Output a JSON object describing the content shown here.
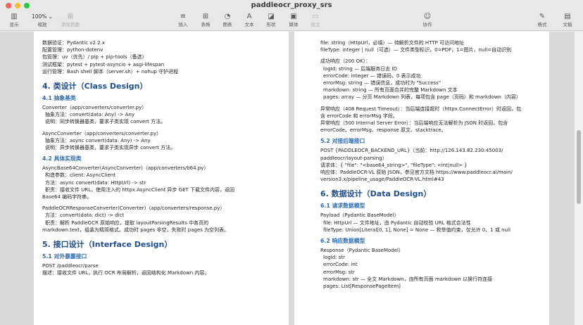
{
  "window": {
    "title": "paddleocr_proxy_srs"
  },
  "toolbar": {
    "view": "显示",
    "zoom_value": "100%",
    "zoom": "缩放",
    "add_page": "添加页面",
    "insert": "插入",
    "table": "表格",
    "chart": "图表",
    "text": "文本",
    "shape": "形状",
    "media": "媒体",
    "comment": "批注",
    "collaborate": "协作",
    "format": "格式",
    "document": "文稿"
  },
  "left_page": {
    "lines_top": [
      "数据验证：Pydantic v2 2.x",
      "配置管理：python-dotenv",
      "包管理：uv（优先）/ pip + pip-tools（备选）",
      "测试框架：pytest + pytest-asyncio + asgi-lifespan",
      "运行管理：Bash shell 脚本（server.sh）+ nohup 守护进程"
    ],
    "h_class": "4. 类设计（Class Design）",
    "h_abstract": "4.1 抽象基类",
    "converter": [
      "Converter（app/converters/converter.py）",
      "抽象方法：convert(data: Any) -> Any",
      "说明：同步转换器基类，要求子类实现 convert 方法。"
    ],
    "async_converter": [
      "AsyncConverter（app/converters/converter.py）",
      "抽象方法：async convert(data: Any) -> Any",
      "说明：异步转换器基类，要求子类实现异步 convert 方法。"
    ],
    "h_impl": "4.2 具体实现类",
    "b64": [
      "AsyncBase64Converter(AsyncConverter)（app/converters/b64.py）",
      "构造参数：client: AsyncClient",
      "方法：async convert(data: HttpUrl) -> str",
      "职责：接收文件 URL，使用注入的 httpx.AsyncClient 异步 GET 下载文件内容，返回",
      "Base64 编码字符串。"
    ],
    "resp_conv": [
      "PaddleOCRResponseConverter(Converter)（app/converters/response.py）",
      "方法：convert(data: dict) -> dict",
      "职责：解析 PaddleOCR 原始响应，提取 layoutParsingResults 中各页的",
      "markdown.text，组装为精简格式。成功时 pages 非空，失败时 pages 为空列表。"
    ],
    "h_interface": "5. 接口设计（Interface Design）",
    "h_exposed": "5.1 对外暴露接口",
    "parse": [
      "POST /paddleocr/parse",
      "描述：接收文件 URL，执行 OCR 布局解析，返回结构化 Markdown 内容。"
    ]
  },
  "right_page": {
    "params": [
      "file: string（HttpUrl，必填）— 待解析文件的 HTTP 可访问地址",
      "fileType: integer | null（可选）— 文件类型标识，0=PDF，1=图片，null=自动识别"
    ],
    "ok": [
      "成功响应（200 OK）：",
      "logId: string — 后端服务日志 ID",
      "errorCode: integer — 错误码，0 表示成功",
      "errorMsg: string — 错误信息，成功时为 \"Success\"",
      "markdown: string — 所有页面合并的完整 Markdown 文本",
      "pages: array — 分页 Markdown 列表，每项包含 page（页码）和 markdown（内容）"
    ],
    "err408": [
      "异常响应（408 Request Timeout）：当后端连接超时（httpx.ConnectError）时返回，包",
      "含 errorCode 和 errorMsg 字段。"
    ],
    "err500": [
      "异常响应（500 Internal Server Error）：当后端响应无法解析为 JSON 时返回，包含",
      "errorCode、errorMsg、response 原文、stacktrace。"
    ],
    "h_backend": "5.2 对接后端接口",
    "backend": [
      "POST {PADDLEOCR_BACKEND_URL}（当前：http://126.143.82.230:45003/",
      "paddleocr/layout-parsing）",
      "请求体：{ \"file\": \"<base64_string>\", \"fileType\": <int|null> }",
      "响应体：PaddleOCR-VL 原始 JSON，参见官方文档 https://www.paddleocr.ai/main/",
      "version3.x/pipeline_usage/PaddleOCR-VL.html#43"
    ],
    "h_data": "6. 数据设计（Data Design）",
    "h_req_model": "6.1 请求数据模型",
    "payload": [
      "Payload（Pydantic BaseModel）",
      "file: HttpUrl — 文件地址，由 Pydantic 自动校验 URL 格式合法性",
      "fileType: Union[Literal[0, 1], None] = None — 枚举值约束，仅允许 0、1 或 null"
    ],
    "h_resp_model": "6.2 响应数据模型",
    "response": [
      "Response（Pydantic BaseModel）",
      "logId: str",
      "errorCode: int",
      "errorMsg: str",
      "markdown: str — 全文 Markdown，由所有页面 markdown 以换行符连接",
      "pages: List[ResponsePageItem]"
    ]
  }
}
